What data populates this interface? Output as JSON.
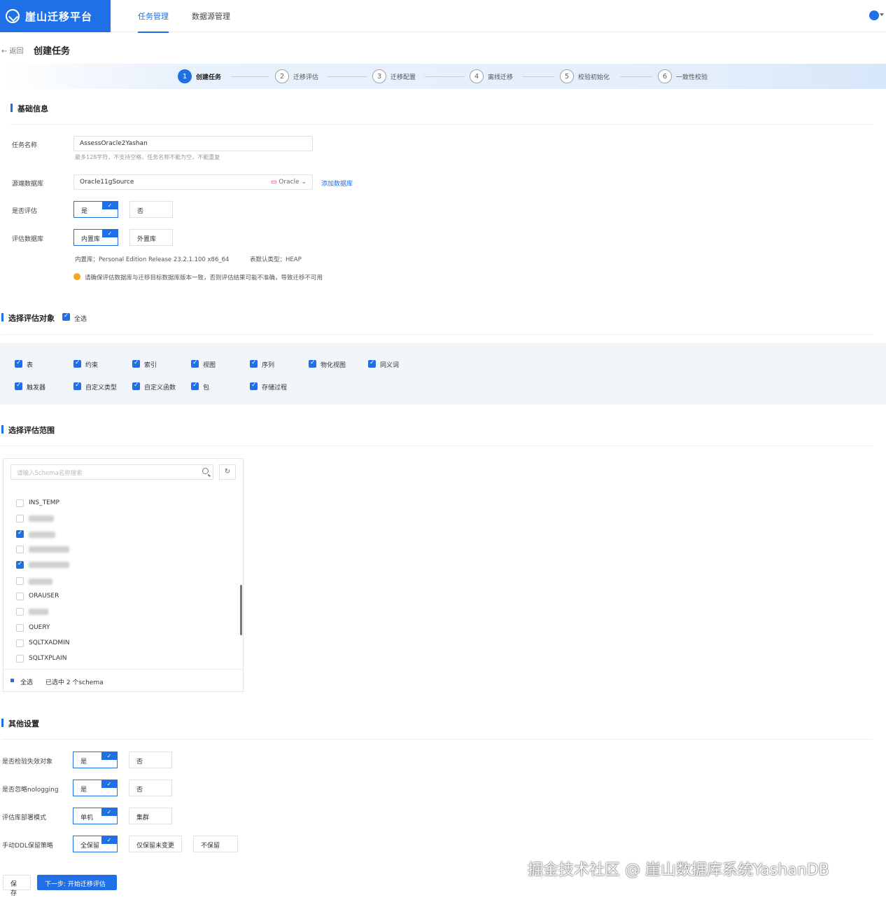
{
  "header": {
    "app_title": "崖山迁移平台",
    "tabs": [
      "任务管理",
      "数据源管理"
    ]
  },
  "breadcrumb": {
    "back": "← 返回",
    "title": "创建任务"
  },
  "steps": [
    {
      "num": "1",
      "label": "创建任务"
    },
    {
      "num": "2",
      "label": "迁移评估"
    },
    {
      "num": "3",
      "label": "迁移配置"
    },
    {
      "num": "4",
      "label": "离线迁移"
    },
    {
      "num": "5",
      "label": "校验初始化"
    },
    {
      "num": "6",
      "label": "一致性校验"
    }
  ],
  "basic": {
    "title": "基础信息",
    "task_name_label": "任务名称",
    "task_name_value": "AssessOracle2Yashan",
    "task_name_hint": "最多128字符，不支持空格，任务名称不能为空，不能重复",
    "source_label": "源端数据库",
    "source_value": "Oracle11gSource",
    "source_type": "Oracle",
    "add_source": "添加数据库",
    "assess_label": "是否评估",
    "yes": "是",
    "no": "否",
    "assess_db_label": "评估数据库",
    "builtin": "内置库",
    "external": "外置库",
    "builtin_info": "内置库：Personal Edition Release 23.2.1.100 x86_64",
    "table_type_info": "表默认类型：HEAP",
    "warning": "请确保评估数据库与迁移目标数据库版本一致，否则评估结果可能不准确，导致迁移不可用"
  },
  "objects": {
    "title": "选择评估对象",
    "select_all": "全选",
    "row1": [
      "表",
      "约束",
      "索引",
      "视图",
      "序列",
      "物化视图",
      "同义词"
    ],
    "row2": [
      "触发器",
      "自定义类型",
      "自定义函数",
      "包",
      "存储过程"
    ]
  },
  "scope": {
    "title": "选择评估范围",
    "search_placeholder": "请输入Schema名称搜索",
    "refresh_glyph": "↻",
    "schemas": [
      "INS_TEMP",
      "ORAUSER",
      "QUERY",
      "SQLTXADMIN",
      "SQLTXPLAIN"
    ],
    "select_all": "全选",
    "selected_count": "已选中 2 个schema"
  },
  "other": {
    "title": "其他设置",
    "opt1_label": "是否检验失效对象",
    "opt2_label": "是否忽略nologging",
    "opt3_label": "评估库部署模式",
    "opt4_label": "手动DDL保留策略",
    "yes": "是",
    "no": "否",
    "single": "单机",
    "cluster": "集群",
    "keep_all": "全保留",
    "keep_unchanged": "仅保留未变更",
    "keep_none": "不保留"
  },
  "footer": {
    "save": "保 存",
    "next": "下一步: 开始迁移评估"
  },
  "watermark": "掘金技术社区 @ 崖山数据库系统YashanDB",
  "colors": {
    "primary": "#1f6fe6",
    "warning": "#f5a623"
  }
}
